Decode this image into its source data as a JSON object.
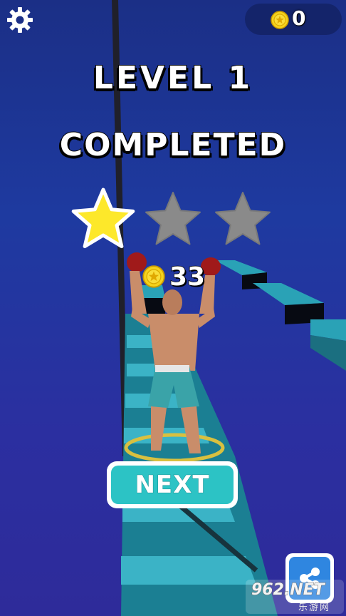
{
  "hud": {
    "settings_icon": "gear-icon",
    "coin_icon": "coin-icon",
    "coin_count": "0"
  },
  "result": {
    "level_label": "LEVEL 1",
    "status_label": "COMPLETED",
    "stars_earned": 1,
    "stars_total": 3,
    "reward_amount": "33"
  },
  "actions": {
    "next_label": "NEXT",
    "share_icon": "share-icon"
  },
  "watermark": {
    "text": "962.NET",
    "subtext": "乐游网"
  },
  "colors": {
    "background": "#1e3aa0",
    "star_earned": "#fde82a",
    "star_empty": "#8a8a8a",
    "next_button": "#2cc3c5",
    "share_button": "#2f86e0",
    "coin": "#f5d21c",
    "coin_pill": "#14246a"
  }
}
